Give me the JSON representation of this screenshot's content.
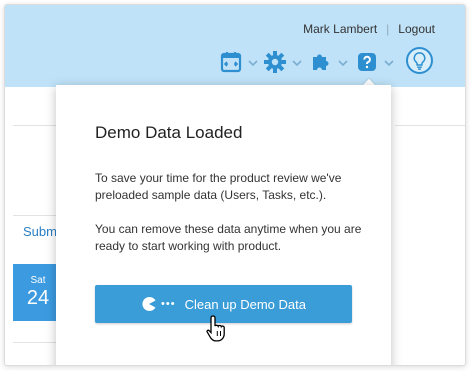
{
  "header": {
    "user_name": "Mark Lambert",
    "separator": "|",
    "logout_label": "Logout",
    "accent_color": "#2e8fd0",
    "icons": [
      "calendar-icon",
      "gear-icon",
      "puzzle-icon",
      "help-icon",
      "lightbulb-icon"
    ]
  },
  "background": {
    "submit_tab": "Subm",
    "date_dow": "Sat",
    "date_day": "24"
  },
  "popup": {
    "title": "Demo Data Loaded",
    "paragraph1": "To save your time for the product review we've preloaded sample data (Users, Tasks, etc.).",
    "paragraph2": "You can remove these data anytime when you are ready to start working with product.",
    "button_label": "Clean up Demo Data",
    "button_color": "#3a9dd8",
    "button_icon": "pacman-icon"
  }
}
